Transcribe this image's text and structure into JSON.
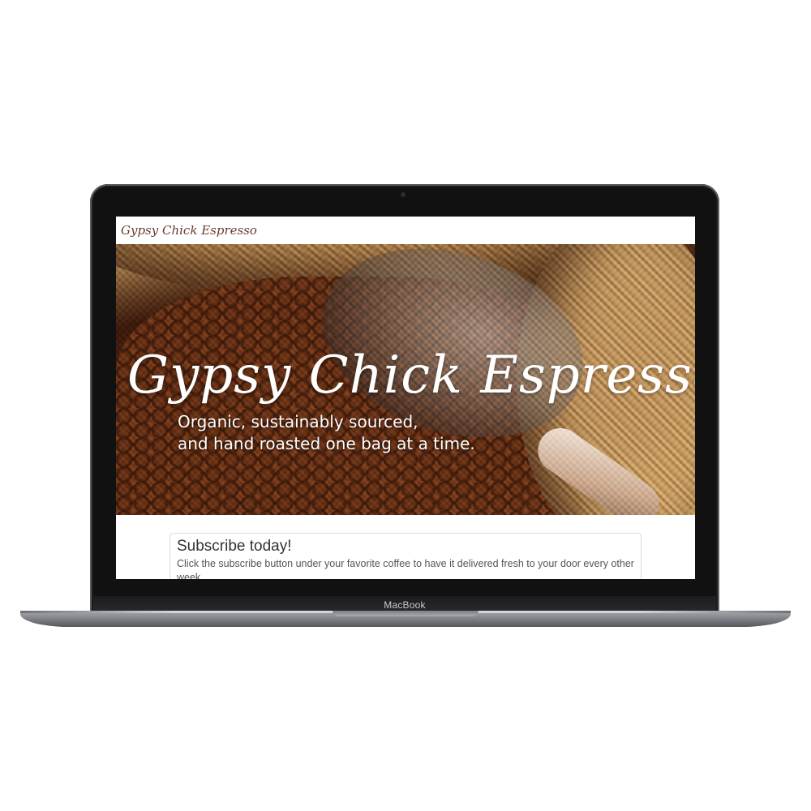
{
  "site": {
    "brand": "Gypsy Chick Espresso"
  },
  "hero": {
    "title": "Gypsy Chick Espresso",
    "tagline_line1": "Organic, sustainably sourced,",
    "tagline_line2": "and hand roasted one bag at a time."
  },
  "subscribe": {
    "title": "Subscribe today!",
    "text": "Click the subscribe button under your favorite coffee to have it delivered fresh to your door every other week."
  },
  "device": {
    "label": "MacBook"
  }
}
